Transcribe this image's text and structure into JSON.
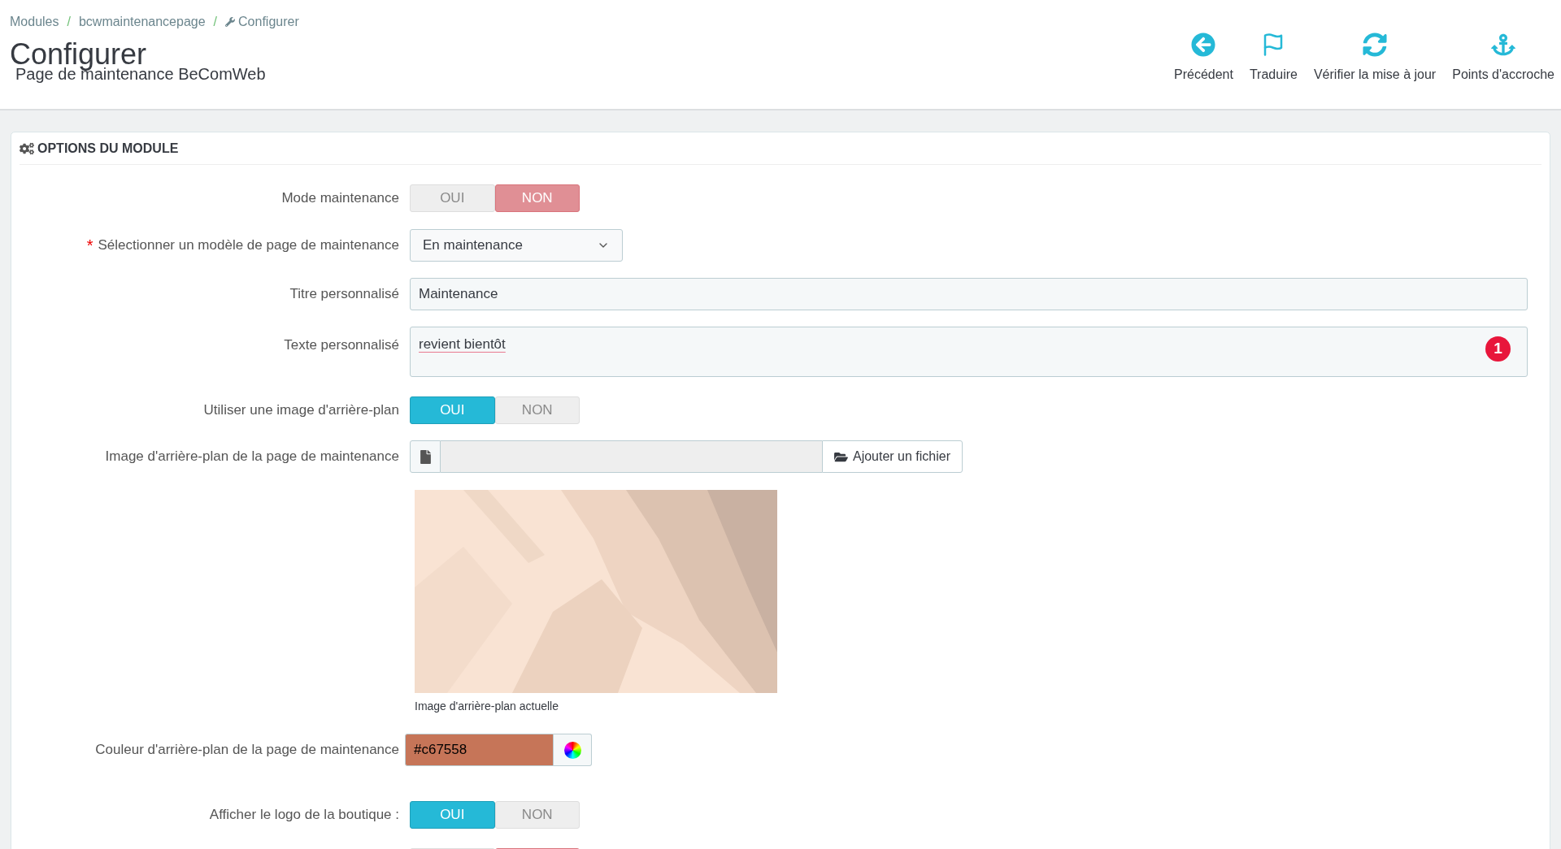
{
  "breadcrumb": [
    {
      "label": "Modules",
      "separator": "/"
    },
    {
      "label": "bcwmaintenancepage",
      "separator": "/"
    },
    {
      "label": "Configurer",
      "kind": "current"
    }
  ],
  "page_title": "Configurer",
  "page_subtitle": "Page de maintenance BeComWeb",
  "toolbar": [
    {
      "kind": "back",
      "label": "Précédent"
    },
    {
      "kind": "translate",
      "label": "Traduire"
    },
    {
      "kind": "update",
      "label": "Vérifier la mise à jour"
    },
    {
      "kind": "hooks",
      "label": "Points d'accroche"
    }
  ],
  "panel": {
    "title": "OPTIONS DU MODULE",
    "fields": [
      {
        "kind": "toggle",
        "label": "Mode maintenance",
        "options": [
          {
            "label": "OUI",
            "selected": false
          },
          {
            "label": "NON",
            "selected": true
          }
        ]
      },
      {
        "kind": "select",
        "label": "Sélectionner un modèle de page de maintenance",
        "required_mark": "*",
        "value": "En maintenance"
      },
      {
        "kind": "text",
        "label": "Titre personnalisé",
        "value": "Maintenance"
      },
      {
        "kind": "textarea",
        "label": "Texte personnalisé",
        "value": "revient bientôt",
        "badge": "1"
      },
      {
        "kind": "toggle",
        "label": "Utiliser une image d'arrière-plan",
        "options": [
          {
            "label": "OUI",
            "selected": true
          },
          {
            "label": "NON",
            "selected": false
          }
        ]
      },
      {
        "kind": "file",
        "label": "Image d'arrière-plan de la page de maintenance",
        "button": "Ajouter un fichier"
      },
      {
        "caption": "Image d'arrière-plan actuelle"
      },
      {
        "kind": "color",
        "label": "Couleur d'arrière-plan de la page de maintenance",
        "value": "#c67558"
      },
      {
        "kind": "toggle",
        "label": "Afficher le logo de la boutique :",
        "options": [
          {
            "label": "OUI",
            "selected": true
          },
          {
            "label": "NON",
            "selected": false
          }
        ]
      },
      {
        "kind": "toggle_cut",
        "options": [
          {
            "selected": false
          },
          {
            "selected": true
          }
        ]
      }
    ]
  }
}
